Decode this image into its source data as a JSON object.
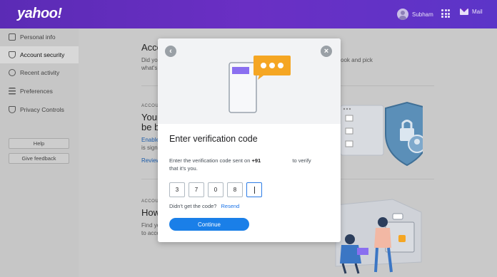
{
  "header": {
    "logo": "yahoo!",
    "user_name": "Subham",
    "mail_label": "Mail"
  },
  "sidebar": {
    "items": [
      {
        "label": "Personal info",
        "icon": "id-card-icon"
      },
      {
        "label": "Account security",
        "icon": "shield-icon"
      },
      {
        "label": "Recent activity",
        "icon": "clock-icon"
      },
      {
        "label": "Preferences",
        "icon": "list-icon"
      },
      {
        "label": "Privacy Controls",
        "icon": "privacy-shield-icon"
      }
    ],
    "help_label": "Help",
    "feedback_label": "Give feedback"
  },
  "background": {
    "title_fragment": "Acco",
    "desc_line1": "Did yo",
    "desc_line2": "what's",
    "desc_right": "ook and pick",
    "section1_label": "ACCOU",
    "section1_heading_1": "Your",
    "section1_heading_2": "be b",
    "section1_link": "Enable",
    "section1_text": "is signi",
    "section1_review": "Review",
    "section2_label": "ACCOU",
    "section2_heading": "How",
    "section2_text_1": "Find yo",
    "section2_text_2": "to acce"
  },
  "modal": {
    "title": "Enter verification code",
    "desc_prefix": "Enter the verification code sent on",
    "phone_prefix": "+91",
    "desc_suffix": "to verify",
    "desc_line2": "that it's you.",
    "code_digits": [
      "3",
      "7",
      "0",
      "8",
      ""
    ],
    "resend_prompt": "Didn't get the code?",
    "resend_label": "Resend",
    "continue_label": "Continue"
  },
  "colors": {
    "header": "#6a2fc4",
    "accent": "#1a7fe8",
    "bubble": "#f5a623",
    "phone_bar": "#8a6ff0"
  }
}
